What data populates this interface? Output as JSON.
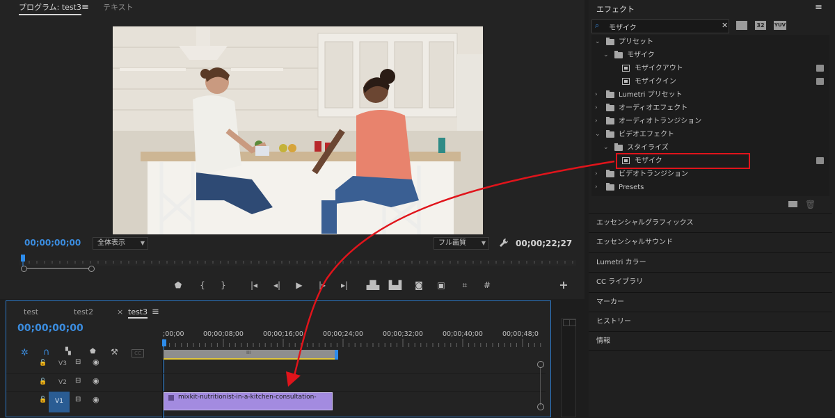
{
  "program_monitor": {
    "tab_program": "プログラム: test3",
    "tab_text": "テキスト",
    "timecode_current": "00;00;00;00",
    "zoom_select": "全体表示",
    "quality_select": "フル画質",
    "timecode_duration": "00;00;22;27"
  },
  "effects": {
    "title": "エフェクト",
    "search_value": "モザイク",
    "filter_btn1": "32",
    "filter_btn2": "YUV",
    "tree": [
      {
        "label": "プリセット"
      },
      {
        "label": "モザイク"
      },
      {
        "label": "モザイクアウト"
      },
      {
        "label": "モザイクイン"
      },
      {
        "label": "Lumetri プリセット"
      },
      {
        "label": "オーディオエフェクト"
      },
      {
        "label": "オーディオトランジション"
      },
      {
        "label": "ビデオエフェクト"
      },
      {
        "label": "スタイライズ"
      },
      {
        "label": "モザイク"
      },
      {
        "label": "ビデオトランジション"
      },
      {
        "label": "Presets"
      }
    ],
    "sections": [
      "エッセンシャルグラフィックス",
      "エッセンシャルサウンド",
      "Lumetri カラー",
      "CC ライブラリ",
      "マーカー",
      "ヒストリー",
      "情報"
    ]
  },
  "timeline": {
    "tabs": [
      "test",
      "test2",
      "test3"
    ],
    "close_mark": "×",
    "timecode": "00;00;00;00",
    "cc_label": "CC",
    "ruler": [
      ";00;00",
      "00;00;08;00",
      "00;00;16;00",
      "00;00;24;00",
      "00;00;32;00",
      "00;00;40;00",
      "00;00;48;0"
    ],
    "tracks": [
      "V3",
      "V2",
      "V1"
    ],
    "work_area_grip": "III",
    "clip_name": "mixkit-nutritionist-in-a-kitchen-consultation-"
  },
  "colors": {
    "accent_blue": "#2d8ceb",
    "highlight_red": "#e0141b",
    "clip_purple": "#a38be0",
    "work_area_yellow": "#e2c83a"
  }
}
